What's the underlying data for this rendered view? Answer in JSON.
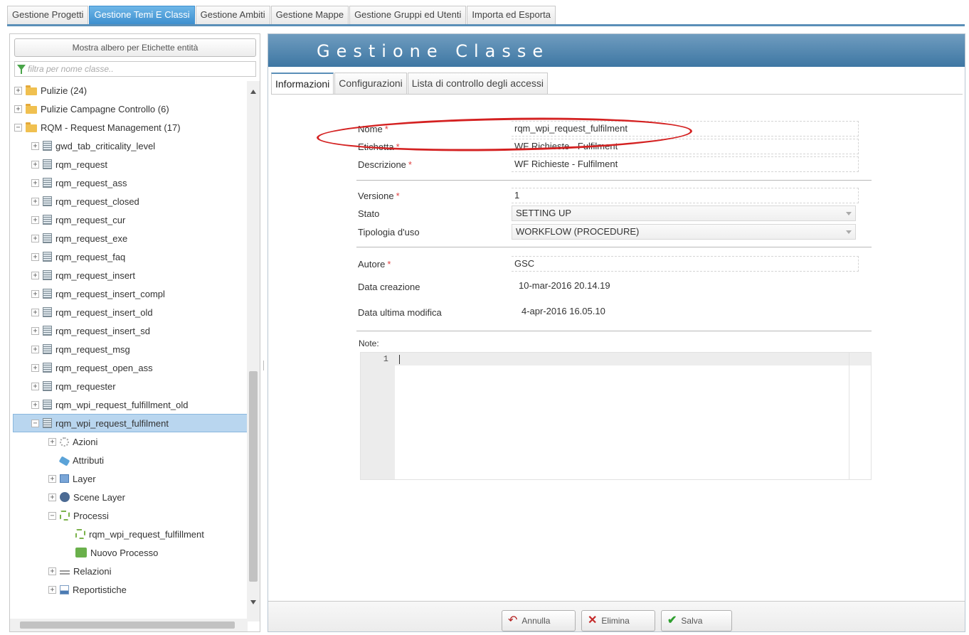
{
  "top_tabs": [
    "Gestione Progetti",
    "Gestione Temi E Classi",
    "Gestione Ambiti",
    "Gestione Mappe",
    "Gestione Gruppi ed Utenti",
    "Importa ed Esporta"
  ],
  "left": {
    "show_tree_label": "Mostra albero per Etichette entità",
    "filter_placeholder": "filtra per nome classe..",
    "tree": [
      {
        "label": "Pulizie (24)"
      },
      {
        "label": "Pulizie Campagne Controllo (6)"
      },
      {
        "label": "RQM - Request Management (17)"
      },
      {
        "label": "gwd_tab_criticality_level"
      },
      {
        "label": "rqm_request"
      },
      {
        "label": "rqm_request_ass"
      },
      {
        "label": "rqm_request_closed"
      },
      {
        "label": "rqm_request_cur"
      },
      {
        "label": "rqm_request_exe"
      },
      {
        "label": "rqm_request_faq"
      },
      {
        "label": "rqm_request_insert"
      },
      {
        "label": "rqm_request_insert_compl"
      },
      {
        "label": "rqm_request_insert_old"
      },
      {
        "label": "rqm_request_insert_sd"
      },
      {
        "label": "rqm_request_msg"
      },
      {
        "label": "rqm_request_open_ass"
      },
      {
        "label": "rqm_requester"
      },
      {
        "label": "rqm_wpi_request_fulfillment_old"
      },
      {
        "label": "rqm_wpi_request_fulfilment"
      },
      {
        "label": "Azioni"
      },
      {
        "label": "Attributi"
      },
      {
        "label": "Layer"
      },
      {
        "label": "Scene Layer"
      },
      {
        "label": "Processi"
      },
      {
        "label": "rqm_wpi_request_fulfillment"
      },
      {
        "label": "Nuovo Processo"
      },
      {
        "label": "Relazioni"
      },
      {
        "label": "Reportistiche"
      }
    ]
  },
  "right": {
    "title": "Gestione Classe",
    "sub_tabs": [
      "Informazioni",
      "Configurazioni",
      "Lista di controllo degli accessi"
    ],
    "required_mark": "*",
    "fields": {
      "nome": {
        "label": "Nome",
        "value": "rqm_wpi_request_fulfilment"
      },
      "etichetta": {
        "label": "Etichetta",
        "value": "WF Richieste - Fulfilment"
      },
      "descrizione": {
        "label": "Descrizione",
        "value": "WF Richieste - Fulfilment"
      },
      "versione": {
        "label": "Versione",
        "value": "1"
      },
      "stato": {
        "label": "Stato",
        "value": "SETTING UP"
      },
      "tipologia": {
        "label": "Tipologia d'uso",
        "value": "WORKFLOW (PROCEDURE)"
      },
      "autore": {
        "label": "Autore",
        "value": "GSC"
      },
      "data_creazione": {
        "label": "Data creazione",
        "value": "10-mar-2016 20.14.19"
      },
      "data_modifica": {
        "label": "Data ultima modifica",
        "value": "4-apr-2016 16.05.10"
      }
    },
    "note_label": "Note:",
    "editor_line": "1",
    "buttons": {
      "annulla": "Annulla",
      "elimina": "Elimina",
      "salva": "Salva"
    }
  }
}
